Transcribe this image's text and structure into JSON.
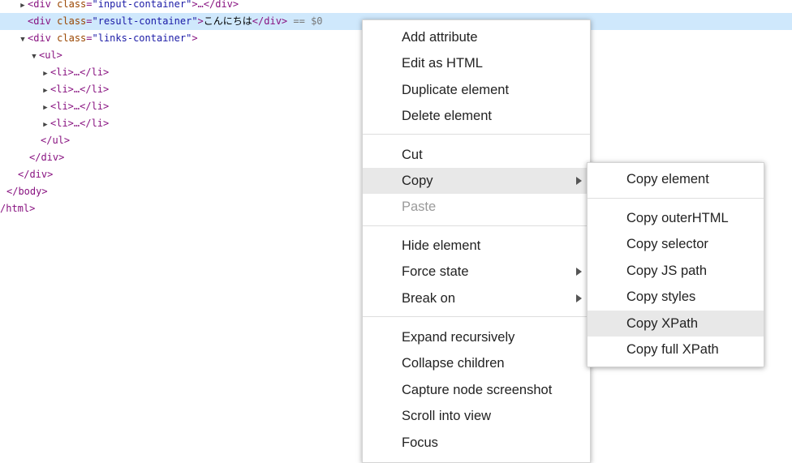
{
  "tree": {
    "line0": {
      "tag_open": "<div",
      "attr": "class",
      "val": "\"input-container\"",
      "rest": ">…</div>"
    },
    "line1": {
      "tag_open": "<div",
      "attr": "class",
      "val": "\"result-container\"",
      "close_bracket": ">",
      "text": "こんにちは",
      "tag_close": "</div>",
      "eq": "== $0"
    },
    "line2": {
      "tag_open": "<div",
      "attr": "class",
      "val": "\"links-container\"",
      "close_bracket": ">"
    },
    "line3": {
      "tag": "<ul>"
    },
    "li_items": [
      {
        "tag": "<li>…</li>"
      },
      {
        "tag": "<li>…</li>"
      },
      {
        "tag": "<li>…</li>"
      },
      {
        "tag": "<li>…</li>"
      }
    ],
    "line8": {
      "tag": "</ul>"
    },
    "line9": {
      "tag": "</div>"
    },
    "line10": {
      "tag": "</div>"
    },
    "line11": {
      "tag": "</body>"
    },
    "line12": {
      "tag": "/html>"
    }
  },
  "context_menu": {
    "add_attribute": "Add attribute",
    "edit_html": "Edit as HTML",
    "duplicate": "Duplicate element",
    "delete": "Delete element",
    "cut": "Cut",
    "copy": "Copy",
    "paste": "Paste",
    "hide": "Hide element",
    "force_state": "Force state",
    "break_on": "Break on",
    "expand": "Expand recursively",
    "collapse": "Collapse children",
    "capture": "Capture node screenshot",
    "scroll": "Scroll into view",
    "focus": "Focus"
  },
  "copy_submenu": {
    "copy_element": "Copy element",
    "copy_outer_html": "Copy outerHTML",
    "copy_selector": "Copy selector",
    "copy_js_path": "Copy JS path",
    "copy_styles": "Copy styles",
    "copy_xpath": "Copy XPath",
    "copy_full_xpath": "Copy full XPath"
  }
}
